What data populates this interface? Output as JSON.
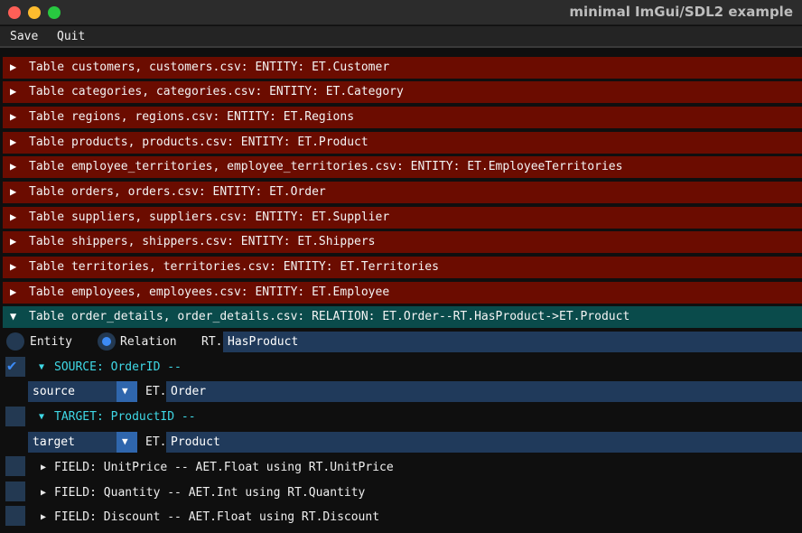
{
  "window": {
    "title": "minimal ImGui/SDL2 example"
  },
  "menu": {
    "save": "Save",
    "quit": "Quit"
  },
  "tables": [
    {
      "label": "Table customers, customers.csv: ENTITY: ET.Customer"
    },
    {
      "label": "Table categories, categories.csv: ENTITY: ET.Category"
    },
    {
      "label": "Table regions, regions.csv: ENTITY: ET.Regions"
    },
    {
      "label": "Table products, products.csv: ENTITY: ET.Product"
    },
    {
      "label": "Table employee_territories, employee_territories.csv: ENTITY: ET.EmployeeTerritories"
    },
    {
      "label": "Table orders, orders.csv: ENTITY: ET.Order"
    },
    {
      "label": "Table suppliers, suppliers.csv: ENTITY: ET.Supplier"
    },
    {
      "label": "Table shippers, shippers.csv: ENTITY: ET.Shippers"
    },
    {
      "label": "Table territories, territories.csv: ENTITY: ET.Territories"
    },
    {
      "label": "Table employees, employees.csv: ENTITY: ET.Employee"
    },
    {
      "label": "Table order_details, order_details.csv: RELATION: ET.Order--RT.HasProduct->ET.Product"
    }
  ],
  "glyphs": {
    "collapsed": "▶",
    "expanded": "▼",
    "small_collapsed": "▶",
    "small_expanded": "▼",
    "combo_arrow": "▼",
    "check": "✔"
  },
  "relation": {
    "entity_label": "Entity",
    "relation_label": "Relation",
    "selected": "Relation",
    "rt_prefix": "RT.",
    "rt_value": "HasProduct",
    "source": {
      "checked": true,
      "label": "SOURCE: OrderID --",
      "role": "source",
      "et_prefix": "ET.",
      "et_value": "Order"
    },
    "target": {
      "checked": false,
      "label": "TARGET: ProductID --",
      "role": "target",
      "et_prefix": "ET.",
      "et_value": "Product"
    },
    "fields": [
      {
        "checked": false,
        "label": "FIELD: UnitPrice -- AET.Float using RT.UnitPrice"
      },
      {
        "checked": false,
        "label": "FIELD: Quantity -- AET.Int using RT.Quantity"
      },
      {
        "checked": false,
        "label": "FIELD: Discount -- AET.Float using RT.Discount"
      }
    ]
  },
  "colors": {
    "collapsed_header": "#6b0c00",
    "expanded_header": "#0a4b4b",
    "accent": "#3d8bf5",
    "frame": "#203a5b",
    "cyan_text": "#3fd8e6"
  }
}
